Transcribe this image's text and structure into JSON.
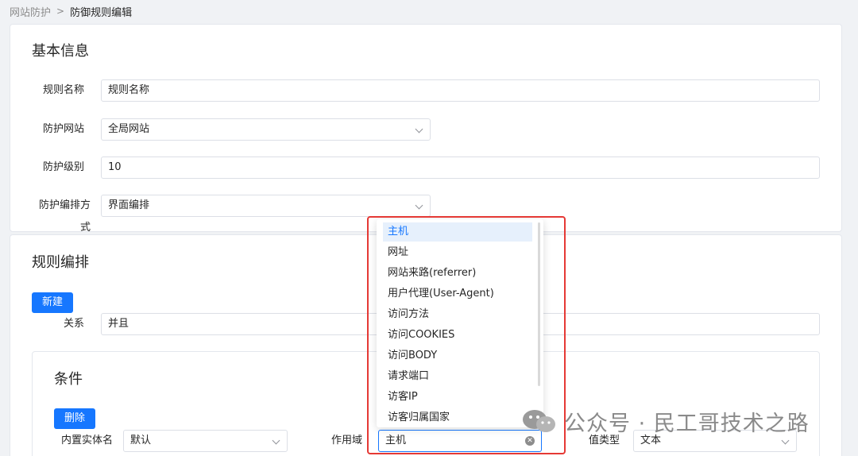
{
  "breadcrumb": {
    "parent": "网站防护",
    "separator": ">",
    "current": "防御规则编辑"
  },
  "basic_info": {
    "title": "基本信息",
    "fields": {
      "rule_name": {
        "label": "规则名称",
        "value": "规则名称"
      },
      "site": {
        "label": "防护网站",
        "value": "全局网站"
      },
      "level": {
        "label": "防护级别",
        "value": "10"
      },
      "mode": {
        "label": "防护编排方式",
        "value": "界面编排"
      }
    }
  },
  "rules": {
    "title": "规则编排",
    "new_button": "新建",
    "relation": {
      "label": "关系",
      "value": "并且"
    }
  },
  "condition": {
    "title": "条件",
    "delete_button": "删除",
    "entity": {
      "label": "内置实体名称",
      "value": "默认"
    },
    "scope": {
      "label": "作用域",
      "value": "主机"
    },
    "value_type": {
      "label": "值类型",
      "value": "文本"
    }
  },
  "dropdown": {
    "options": [
      "主机",
      "网址",
      "网站来路(referrer)",
      "用户代理(User-Agent)",
      "访问方法",
      "访问COOKIES",
      "访问BODY",
      "请求端口",
      "访客IP",
      "访客归属国家"
    ],
    "selected_index": 0
  },
  "watermark": {
    "text": "公众号 · 民工哥技术之路"
  },
  "colors": {
    "primary": "#1677ff",
    "highlight": "#e53935"
  }
}
